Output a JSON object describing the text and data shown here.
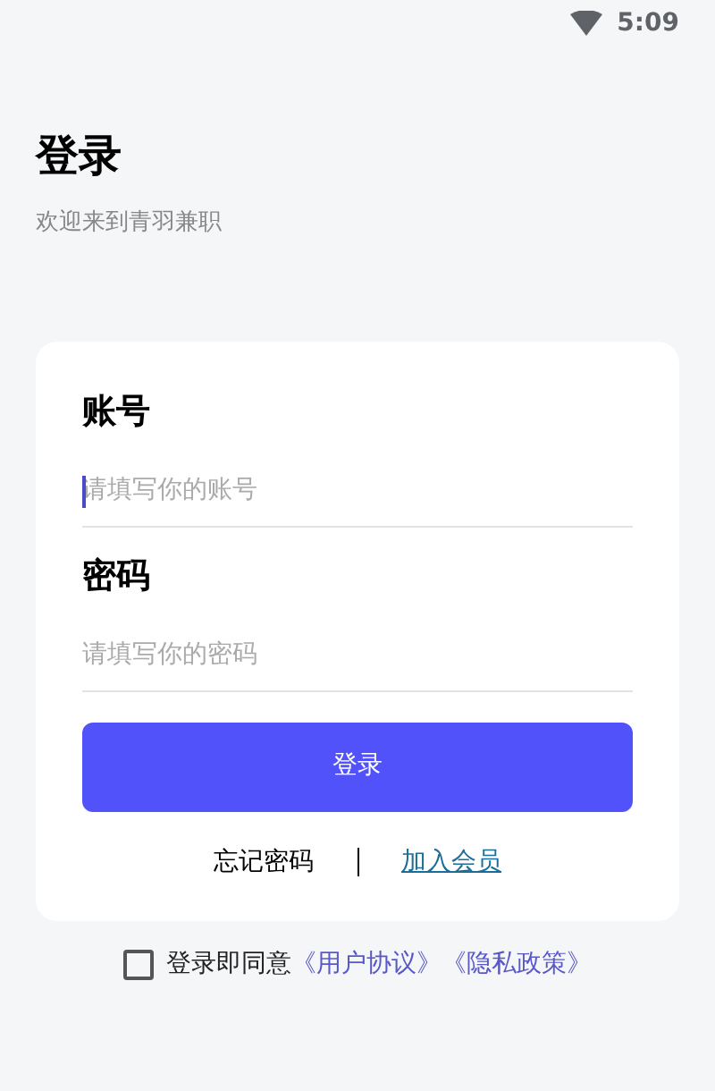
{
  "status_bar": {
    "time": "5:09"
  },
  "header": {
    "title": "登录",
    "subtitle": "欢迎来到青羽兼职"
  },
  "form": {
    "fields": [
      {
        "label": "账号",
        "placeholder": "请填写你的账号",
        "focused": true
      },
      {
        "label": "密码",
        "placeholder": "请填写你的密码",
        "focused": false
      }
    ],
    "submit": "登录",
    "links": [
      {
        "text": "忘记密码",
        "kind": "plain"
      },
      {
        "text": "加入会员",
        "kind": "link"
      }
    ]
  },
  "agreement": {
    "checked": false,
    "text": "登录即同意",
    "links": [
      "《用户协议》",
      "《隐私政策》"
    ]
  }
}
